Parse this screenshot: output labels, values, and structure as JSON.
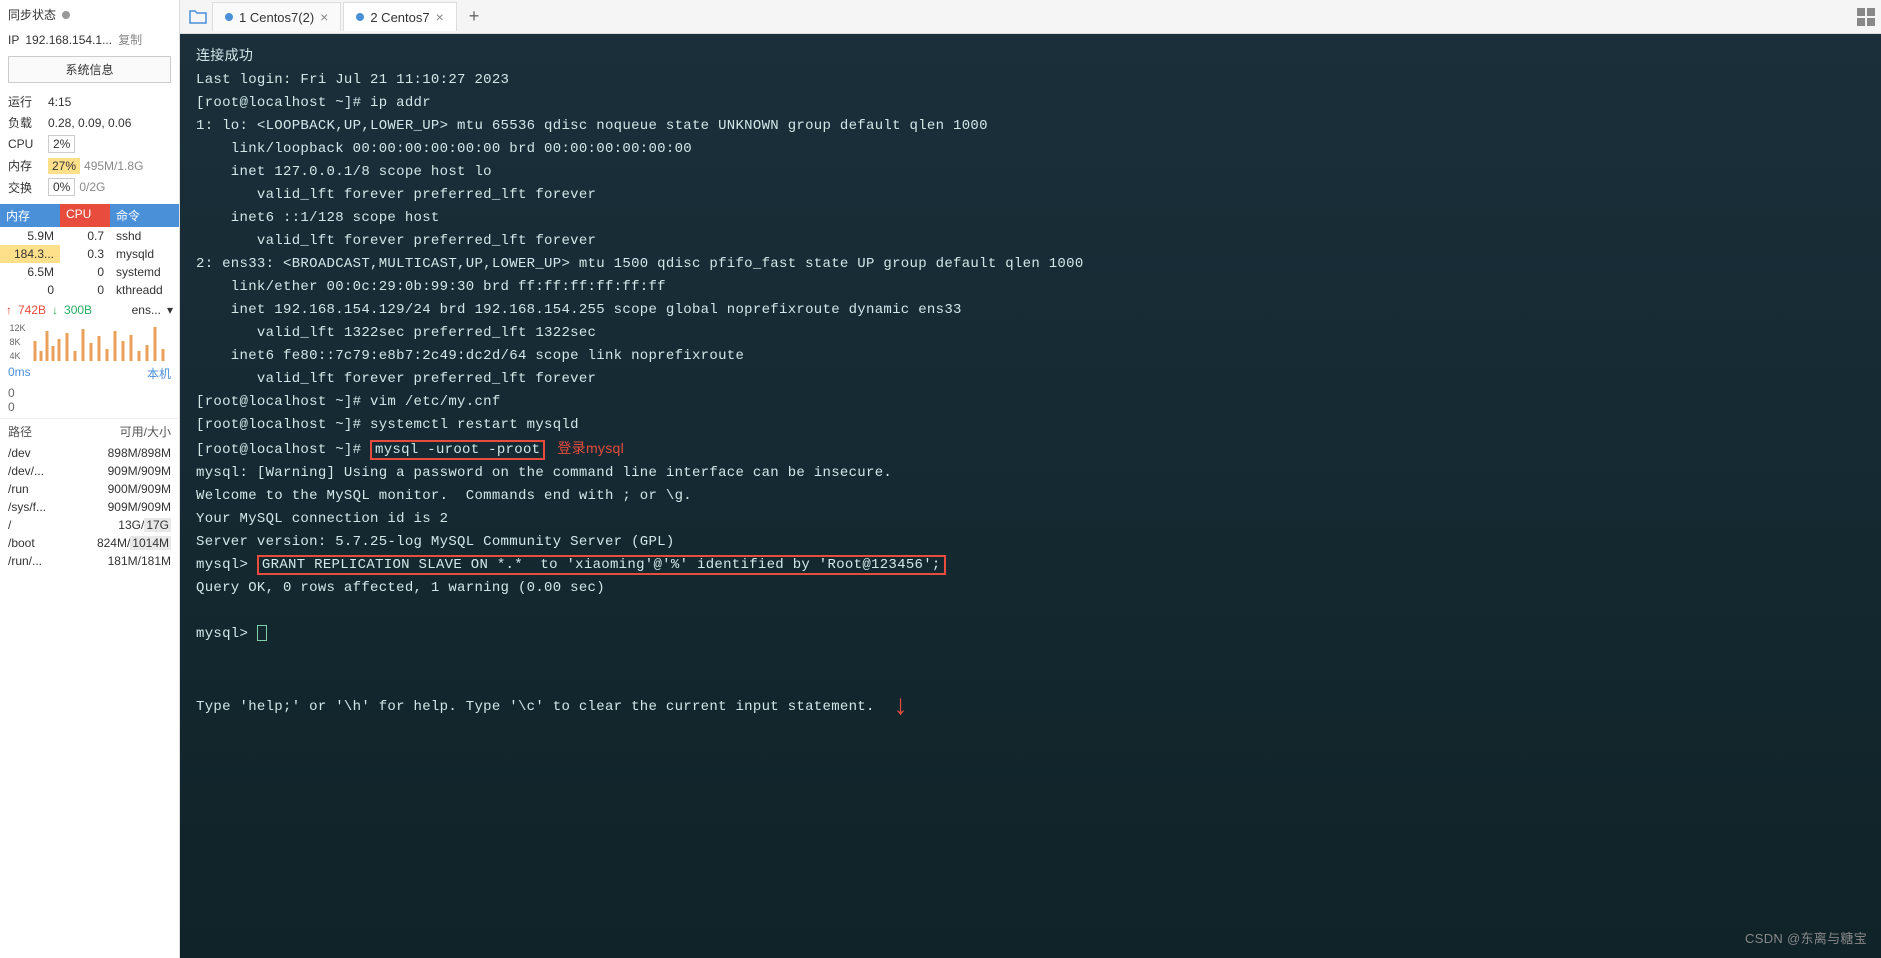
{
  "sidebar": {
    "sync_label": "同步状态",
    "ip_label": "IP",
    "ip_value": "192.168.154.1...",
    "copy": "复制",
    "sysinfo_btn": "系统信息",
    "runtime_label": "运行",
    "runtime_value": "4:15",
    "load_label": "负载",
    "load_value": "0.28, 0.09, 0.06",
    "cpu_label": "CPU",
    "cpu_value": "2%",
    "mem_label": "内存",
    "mem_pct": "27%",
    "mem_detail": "495M/1.8G",
    "swap_label": "交换",
    "swap_pct": "0%",
    "swap_detail": "0/2G",
    "th_mem": "内存",
    "th_cpu": "CPU",
    "th_cmd": "命令",
    "procs": [
      {
        "mem": "5.9M",
        "cpu": "0.7",
        "cmd": "sshd"
      },
      {
        "mem": "184.3...",
        "cpu": "0.3",
        "cmd": "mysqld"
      },
      {
        "mem": "6.5M",
        "cpu": "0",
        "cmd": "systemd"
      },
      {
        "mem": "0",
        "cpu": "0",
        "cmd": "kthreadd"
      }
    ],
    "net_up": "742B",
    "net_down": "300B",
    "net_if": "ens...",
    "spark_labels": [
      "12K",
      "8K",
      "4K"
    ],
    "latency": "0ms",
    "local": "本机",
    "zeros": [
      "0",
      "0"
    ],
    "disk_th_path": "路径",
    "disk_th_size": "可用/大小",
    "disks": [
      {
        "p": "/dev",
        "s": "898M/898M"
      },
      {
        "p": "/dev/...",
        "s": "909M/909M"
      },
      {
        "p": "/run",
        "s": "900M/909M"
      },
      {
        "p": "/sys/f...",
        "s": "909M/909M"
      },
      {
        "p": "/",
        "s": "13G/17G"
      },
      {
        "p": "/boot",
        "s": "824M/1014M"
      },
      {
        "p": "/run/...",
        "s": "181M/181M"
      }
    ]
  },
  "tabs": [
    {
      "label": "1 Centos7(2)",
      "active": false
    },
    {
      "label": "2 Centos7",
      "active": true
    }
  ],
  "terminal": {
    "lines_pre": [
      "连接成功",
      "Last login: Fri Jul 21 11:10:27 2023",
      "[root@localhost ~]# ip addr",
      "1: lo: <LOOPBACK,UP,LOWER_UP> mtu 65536 qdisc noqueue state UNKNOWN group default qlen 1000",
      "    link/loopback 00:00:00:00:00:00 brd 00:00:00:00:00:00",
      "    inet 127.0.0.1/8 scope host lo",
      "       valid_lft forever preferred_lft forever",
      "    inet6 ::1/128 scope host ",
      "       valid_lft forever preferred_lft forever",
      "2: ens33: <BROADCAST,MULTICAST,UP,LOWER_UP> mtu 1500 qdisc pfifo_fast state UP group default qlen 1000",
      "    link/ether 00:0c:29:0b:99:30 brd ff:ff:ff:ff:ff:ff",
      "    inet 192.168.154.129/24 brd 192.168.154.255 scope global noprefixroute dynamic ens33",
      "       valid_lft 1322sec preferred_lft 1322sec",
      "    inet6 fe80::7c79:e8b7:2c49:dc2d/64 scope link noprefixroute ",
      "       valid_lft forever preferred_lft forever",
      "[root@localhost ~]# vim /etc/my.cnf",
      "[root@localhost ~]# systemctl restart mysqld"
    ],
    "login_prefix": "[root@localhost ~]# ",
    "login_cmd": "mysql -uroot -proot",
    "login_note": "登录mysql",
    "lines_mid": [
      "mysql: [Warning] Using a password on the command line interface can be insecure.",
      "Welcome to the MySQL monitor.  Commands end with ; or \\g.",
      "Your MySQL connection id is 2",
      "Server version: 5.7.25-log MySQL Community Server (GPL)",
      ""
    ],
    "grant_prefix": "mysql> ",
    "grant_cmd": "GRANT REPLICATION SLAVE ON *.*  to 'xiaoming'@'%' identified by 'Root@123456';",
    "grant_result": "Query OK, 0 rows affected, 1 warning (0.00 sec)",
    "prompt": "mysql> ",
    "help_line": "Type 'help;' or '\\h' for help. Type '\\c' to clear the current input statement.  "
  },
  "watermark": "CSDN @东离与糖宝"
}
